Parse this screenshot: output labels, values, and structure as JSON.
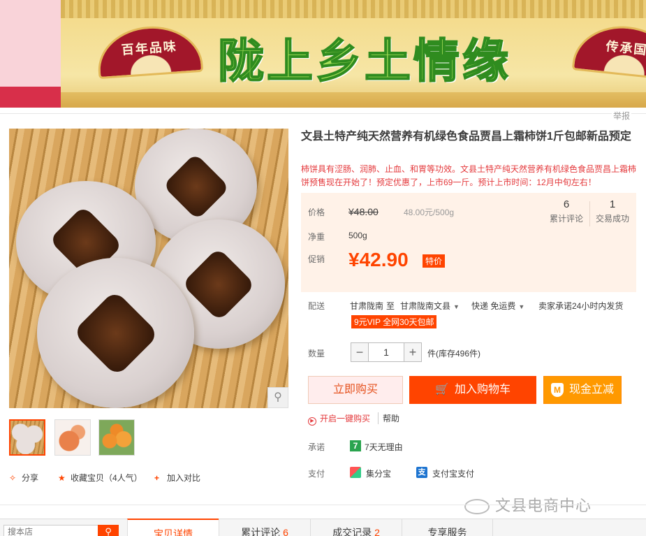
{
  "banner": {
    "title": "陇上乡土情缘",
    "left_fan_text": "百年品味",
    "right_fan_text": "传承国"
  },
  "report_link": "举报",
  "product": {
    "title": "文县土特产纯天然营养有机绿色食品贾昌上霜柿饼1斤包邮新品预定",
    "subtitle": "柿饼具有涩肠、润肺、止血、和胃等功效。文县土特产纯天然营养有机绿色食品贾昌上霜柿饼预售现在开始了！预定优惠了，上市69一斤。预计上市时间：12月中旬左右！"
  },
  "price_box": {
    "price_label": "价格",
    "original_price": "¥48.00",
    "unit_price": "48.00元/500g",
    "weight_label": "净重",
    "weight_value": "500g",
    "promo_label": "促销",
    "promo_price": "¥42.90",
    "promo_tag": "特价",
    "reviews_count": "6",
    "reviews_label": "累计评论",
    "deals_count": "1",
    "deals_label": "交易成功"
  },
  "shipping": {
    "label": "配送",
    "from": "甘肃陇南",
    "to_word": "至",
    "to": "甘肃陇南文县",
    "method": "快递 免运费",
    "promise": "卖家承诺24小时内发货",
    "vip_tag": "9元VIP 全网30天包邮"
  },
  "quantity": {
    "label": "数量",
    "minus": "−",
    "value": "1",
    "plus": "+",
    "stock": "件(库存496件)"
  },
  "buttons": {
    "buy_now": "立即购买",
    "add_cart": "加入购物车",
    "cash_off": "现金立减"
  },
  "one_click": "开启一键购买",
  "help": "帮助",
  "promise": {
    "label": "承诺",
    "badge": "7",
    "text": "7天无理由"
  },
  "payment": {
    "label": "支付",
    "jifen": "集分宝",
    "alipay": "支付宝支付"
  },
  "left_actions": {
    "share": "分享",
    "favorite": "收藏宝贝（4人气）",
    "compare": "加入对比"
  },
  "watermark": "文县电商中心",
  "bottom": {
    "search_placeholder": "搜本店",
    "tabs": [
      {
        "label": "宝贝详情",
        "count": ""
      },
      {
        "label": "累计评论",
        "count": "6"
      },
      {
        "label": "成交记录",
        "count": "2"
      },
      {
        "label": "专享服务",
        "count": ""
      }
    ]
  },
  "colors": {
    "accent": "#ff4400",
    "orange": "#ff9900",
    "price_box_bg": "#fff2e8"
  }
}
